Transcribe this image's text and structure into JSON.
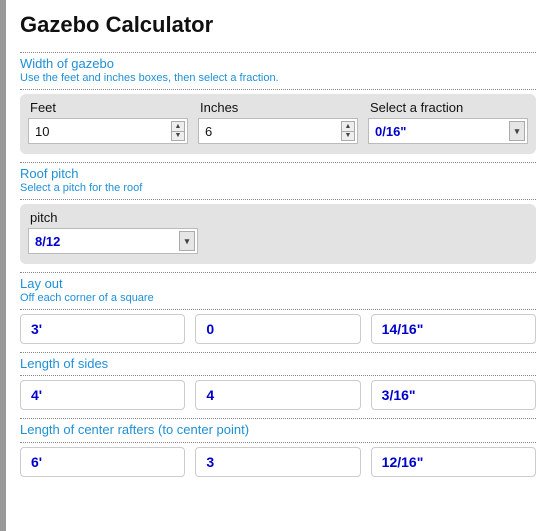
{
  "title": "Gazebo Calculator",
  "width_section": {
    "title": "Width of gazebo",
    "subtitle": "Use the feet and inches boxes, then select a fraction.",
    "feet_label": "Feet",
    "feet_value": "10",
    "inches_label": "Inches",
    "inches_value": "6",
    "fraction_label": "Select a fraction",
    "fraction_value": "0/16\""
  },
  "pitch_section": {
    "title": "Roof pitch",
    "subtitle": "Select a pitch for the roof",
    "pitch_label": "pitch",
    "pitch_value": "8/12"
  },
  "layout_section": {
    "title": "Lay out",
    "subtitle": "Off each corner of a square",
    "feet": "3'",
    "inches": "0",
    "fraction": "14/16\""
  },
  "sides_section": {
    "title": "Length of sides",
    "feet": "4'",
    "inches": "4",
    "fraction": "3/16\""
  },
  "rafters_section": {
    "title": "Length of center rafters (to center point)",
    "feet": "6'",
    "inches": "3",
    "fraction": "12/16\""
  }
}
